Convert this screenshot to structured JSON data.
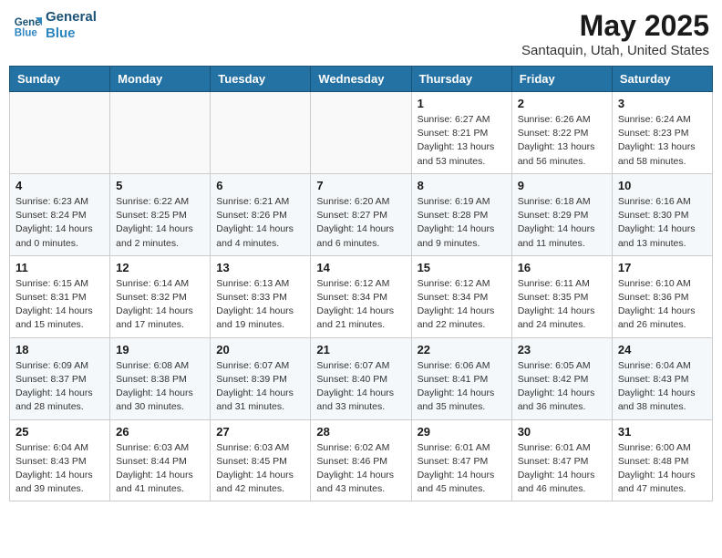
{
  "header": {
    "logo_line1": "General",
    "logo_line2": "Blue",
    "title": "May 2025",
    "subtitle": "Santaquin, Utah, United States"
  },
  "weekdays": [
    "Sunday",
    "Monday",
    "Tuesday",
    "Wednesday",
    "Thursday",
    "Friday",
    "Saturday"
  ],
  "weeks": [
    [
      {
        "day": "",
        "info": ""
      },
      {
        "day": "",
        "info": ""
      },
      {
        "day": "",
        "info": ""
      },
      {
        "day": "",
        "info": ""
      },
      {
        "day": "1",
        "info": "Sunrise: 6:27 AM\nSunset: 8:21 PM\nDaylight: 13 hours\nand 53 minutes."
      },
      {
        "day": "2",
        "info": "Sunrise: 6:26 AM\nSunset: 8:22 PM\nDaylight: 13 hours\nand 56 minutes."
      },
      {
        "day": "3",
        "info": "Sunrise: 6:24 AM\nSunset: 8:23 PM\nDaylight: 13 hours\nand 58 minutes."
      }
    ],
    [
      {
        "day": "4",
        "info": "Sunrise: 6:23 AM\nSunset: 8:24 PM\nDaylight: 14 hours\nand 0 minutes."
      },
      {
        "day": "5",
        "info": "Sunrise: 6:22 AM\nSunset: 8:25 PM\nDaylight: 14 hours\nand 2 minutes."
      },
      {
        "day": "6",
        "info": "Sunrise: 6:21 AM\nSunset: 8:26 PM\nDaylight: 14 hours\nand 4 minutes."
      },
      {
        "day": "7",
        "info": "Sunrise: 6:20 AM\nSunset: 8:27 PM\nDaylight: 14 hours\nand 6 minutes."
      },
      {
        "day": "8",
        "info": "Sunrise: 6:19 AM\nSunset: 8:28 PM\nDaylight: 14 hours\nand 9 minutes."
      },
      {
        "day": "9",
        "info": "Sunrise: 6:18 AM\nSunset: 8:29 PM\nDaylight: 14 hours\nand 11 minutes."
      },
      {
        "day": "10",
        "info": "Sunrise: 6:16 AM\nSunset: 8:30 PM\nDaylight: 14 hours\nand 13 minutes."
      }
    ],
    [
      {
        "day": "11",
        "info": "Sunrise: 6:15 AM\nSunset: 8:31 PM\nDaylight: 14 hours\nand 15 minutes."
      },
      {
        "day": "12",
        "info": "Sunrise: 6:14 AM\nSunset: 8:32 PM\nDaylight: 14 hours\nand 17 minutes."
      },
      {
        "day": "13",
        "info": "Sunrise: 6:13 AM\nSunset: 8:33 PM\nDaylight: 14 hours\nand 19 minutes."
      },
      {
        "day": "14",
        "info": "Sunrise: 6:12 AM\nSunset: 8:34 PM\nDaylight: 14 hours\nand 21 minutes."
      },
      {
        "day": "15",
        "info": "Sunrise: 6:12 AM\nSunset: 8:34 PM\nDaylight: 14 hours\nand 22 minutes."
      },
      {
        "day": "16",
        "info": "Sunrise: 6:11 AM\nSunset: 8:35 PM\nDaylight: 14 hours\nand 24 minutes."
      },
      {
        "day": "17",
        "info": "Sunrise: 6:10 AM\nSunset: 8:36 PM\nDaylight: 14 hours\nand 26 minutes."
      }
    ],
    [
      {
        "day": "18",
        "info": "Sunrise: 6:09 AM\nSunset: 8:37 PM\nDaylight: 14 hours\nand 28 minutes."
      },
      {
        "day": "19",
        "info": "Sunrise: 6:08 AM\nSunset: 8:38 PM\nDaylight: 14 hours\nand 30 minutes."
      },
      {
        "day": "20",
        "info": "Sunrise: 6:07 AM\nSunset: 8:39 PM\nDaylight: 14 hours\nand 31 minutes."
      },
      {
        "day": "21",
        "info": "Sunrise: 6:07 AM\nSunset: 8:40 PM\nDaylight: 14 hours\nand 33 minutes."
      },
      {
        "day": "22",
        "info": "Sunrise: 6:06 AM\nSunset: 8:41 PM\nDaylight: 14 hours\nand 35 minutes."
      },
      {
        "day": "23",
        "info": "Sunrise: 6:05 AM\nSunset: 8:42 PM\nDaylight: 14 hours\nand 36 minutes."
      },
      {
        "day": "24",
        "info": "Sunrise: 6:04 AM\nSunset: 8:43 PM\nDaylight: 14 hours\nand 38 minutes."
      }
    ],
    [
      {
        "day": "25",
        "info": "Sunrise: 6:04 AM\nSunset: 8:43 PM\nDaylight: 14 hours\nand 39 minutes."
      },
      {
        "day": "26",
        "info": "Sunrise: 6:03 AM\nSunset: 8:44 PM\nDaylight: 14 hours\nand 41 minutes."
      },
      {
        "day": "27",
        "info": "Sunrise: 6:03 AM\nSunset: 8:45 PM\nDaylight: 14 hours\nand 42 minutes."
      },
      {
        "day": "28",
        "info": "Sunrise: 6:02 AM\nSunset: 8:46 PM\nDaylight: 14 hours\nand 43 minutes."
      },
      {
        "day": "29",
        "info": "Sunrise: 6:01 AM\nSunset: 8:47 PM\nDaylight: 14 hours\nand 45 minutes."
      },
      {
        "day": "30",
        "info": "Sunrise: 6:01 AM\nSunset: 8:47 PM\nDaylight: 14 hours\nand 46 minutes."
      },
      {
        "day": "31",
        "info": "Sunrise: 6:00 AM\nSunset: 8:48 PM\nDaylight: 14 hours\nand 47 minutes."
      }
    ]
  ]
}
